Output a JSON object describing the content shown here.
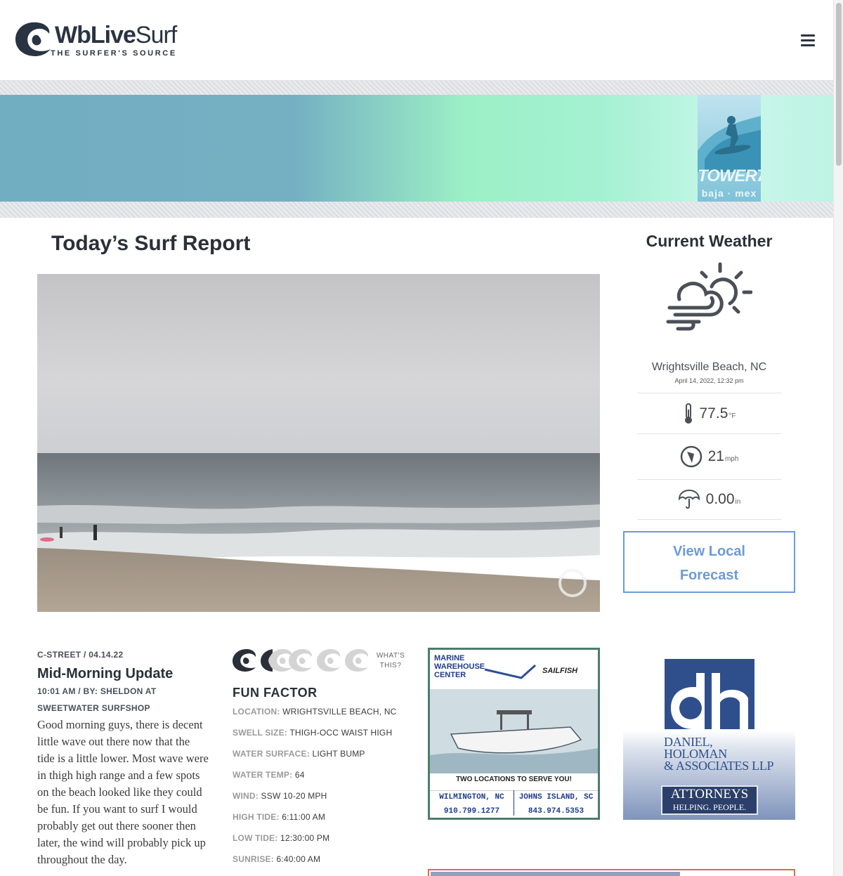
{
  "header": {
    "logo_word_bold": "WbLive",
    "logo_word_light": "Surf",
    "logo_tagline": "THE SURFER'S SOURCE"
  },
  "banner_ad": {
    "brand": "TOWER7",
    "sub": "baja · mex"
  },
  "report": {
    "title_bold": "Today’s Surf",
    "title_light": " Report"
  },
  "weather": {
    "title_bold": "Current",
    "title_light": " Weather",
    "icon": "partly-cloudy-windy-icon",
    "location": "Wrightsville Beach, NC",
    "datetime": "April 14, 2022, 12:32 pm",
    "temperature": "77.5",
    "temperature_unit": "°F",
    "wind": "21",
    "wind_unit": "mph",
    "precip": "0.00",
    "precip_unit": "in",
    "forecast_button_line1": "View Local",
    "forecast_button_line2": "Forecast"
  },
  "post": {
    "meta": "C-STREET / 04.14.22",
    "title": "Mid-Morning Update",
    "byline": "10:01 AM / BY: SHELDON AT SWEETWATER SURFSHOP",
    "body": "Good morning guys, there is decent little wave out there now that the tide is a little lower.  Most wave were in thigh high range and a few spots on the beach looked like they could be fun.  If you want to surf I would probably get out there sooner then later, the wind will probably pick up throughout the day."
  },
  "conditions": {
    "rating": 1.5,
    "rating_max": 5,
    "whats_this": "WHAT'S THIS?",
    "fun_factor": "FUN FACTOR",
    "rows": [
      {
        "label": "LOCATION:",
        "value": "WRIGHTSVILLE BEACH, NC"
      },
      {
        "label": "SWELL SIZE:",
        "value": "THIGH-OCC WAIST HIGH"
      },
      {
        "label": "WATER SURFACE:",
        "value": "LIGHT BUMP"
      },
      {
        "label": "WATER TEMP:",
        "value": "64"
      },
      {
        "label": "WIND:",
        "value": "SSW 10-20 MPH"
      },
      {
        "label": "HIGH TIDE:",
        "value": "6:11:00 AM"
      },
      {
        "label": "LOW TIDE:",
        "value": "12:30:00 PM"
      },
      {
        "label": "SUNRISE:",
        "value": "6:40:00 AM"
      }
    ]
  },
  "ads": {
    "marine": {
      "name_line1": "MARINE",
      "name_line2": "WAREHOUSE",
      "name_line3": "CENTER",
      "partner": "SAILFISH",
      "tagline": "TWO LOCATIONS TO SERVE YOU!",
      "loc1_city": "WILMINGTON, NC",
      "loc1_phone": "910.799.1277",
      "loc2_city": "JOHNS ISLAND, SC",
      "loc2_phone": "843.974.5353"
    },
    "dh": {
      "name_line1": "DANIEL,",
      "name_line2": "HOLOMAN",
      "name_line3": "& ASSOCIATES LLP",
      "tag1": "ATTORNEYS",
      "tag2": "HELPING. PEOPLE."
    }
  }
}
